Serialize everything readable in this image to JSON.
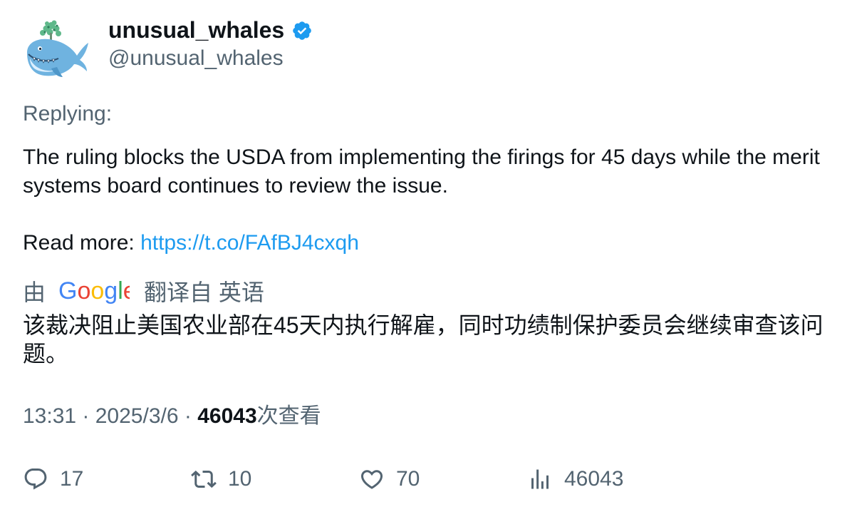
{
  "author": {
    "display_name": "unusual_whales",
    "handle": "@unusual_whales",
    "verified_icon": "verified-badge-icon",
    "verified_color": "#1d9bf0"
  },
  "tweet": {
    "replying_label": "Replying:",
    "text": "The ruling blocks the USDA from implementing the firings for 45 days while the merit systems board continues to review the issue.",
    "read_more_label": "Read more: ",
    "link": "https://t.co/FAfBJ4cxqh"
  },
  "translation": {
    "by_label": "由",
    "provider": "Google",
    "translated_from_label": "翻译自 英语",
    "translated_text": "该裁决阻止美国农业部在45天内执行解雇，同时功绩制保护委员会继续审查该问题。"
  },
  "meta": {
    "time": "13:31",
    "separator": " · ",
    "date": "2025/3/6",
    "views_count": "46043",
    "views_label": "次查看"
  },
  "actions": {
    "reply_count": "17",
    "retweet_count": "10",
    "like_count": "70",
    "views_count": "46043"
  },
  "colors": {
    "text_primary": "#0f1419",
    "text_secondary": "#536471",
    "link": "#1d9bf0"
  }
}
